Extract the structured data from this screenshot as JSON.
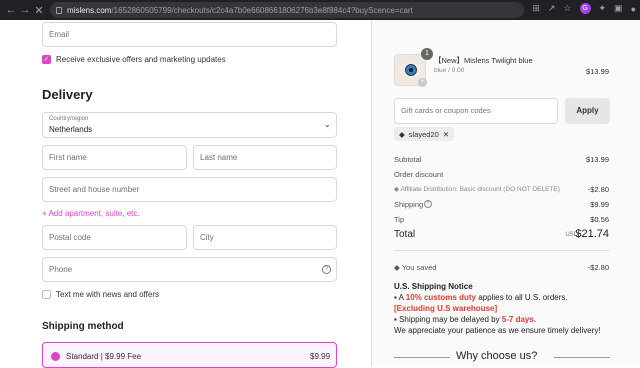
{
  "browser": {
    "url_host": "mislens.com",
    "url_path": "/1652860505799/checkouts/c2c4a7b0e6608661806276b3e8f884c4?buyScence=cart"
  },
  "contact": {
    "email_placeholder": "Email",
    "offers_label": "Receive exclusive offers and marketing updates"
  },
  "delivery": {
    "title": "Delivery",
    "country_label": "Country/region",
    "country_value": "Netherlands",
    "first_name_placeholder": "First name",
    "last_name_placeholder": "Last name",
    "address_placeholder": "Street and house number",
    "add_apartment": "+ Add apartment, suite, etc.",
    "postal_placeholder": "Postal code",
    "city_placeholder": "City",
    "phone_placeholder": "Phone",
    "news_label": "Text me with news and offers"
  },
  "shipping_method": {
    "title": "Shipping method",
    "option_label": "Standard | $9.99 Fee",
    "option_price": "$9.99"
  },
  "summary": {
    "product": {
      "name": "【New】Mislens Twilight blue",
      "variant": "blue / 0.00",
      "price": "$13.99",
      "quantity": "1"
    },
    "coupon_placeholder": "Gift cards or coupon codes",
    "apply_label": "Apply",
    "applied_code": "slayed20",
    "subtotal_label": "Subtotal",
    "subtotal_value": "$13.99",
    "order_discount_label": "Order discount",
    "affiliate_label": "Affiliate Distribution: Basic discount (DO NOT DELETE)",
    "affiliate_value": "-$2.80",
    "shipping_label": "Shipping",
    "shipping_value": "$9.99",
    "tip_label": "Tip",
    "tip_value": "$0.56",
    "total_label": "Total",
    "total_currency": "USD",
    "total_value": "$21.74",
    "saved_label": "You saved",
    "saved_value": "-$2.80"
  },
  "notice": {
    "title": "U.S. Shipping Notice",
    "line1_pre": "A ",
    "line1_red": "10% customs duty",
    "line1_post": " applies to all U.S. orders.",
    "line2_red": "[Excluding U.S warehouse]",
    "line3_pre": "Shipping may be delayed by ",
    "line3_red": "5-7 days.",
    "line4": "We appreciate your patience as we ensure timely delivery!"
  },
  "why_title": "Why choose us?",
  "colors": {
    "accent": "#d946c4",
    "alert": "#e03a2f"
  }
}
